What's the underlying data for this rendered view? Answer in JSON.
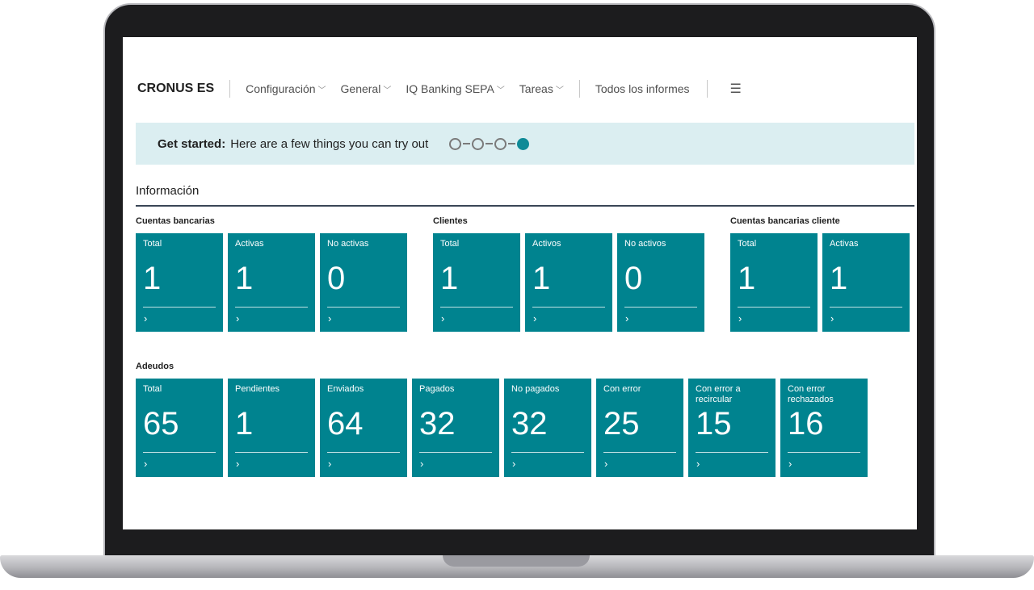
{
  "nav": {
    "brand": "CRONUS ES",
    "menus": [
      {
        "label": "Configuración"
      },
      {
        "label": "General"
      },
      {
        "label": "IQ Banking SEPA"
      },
      {
        "label": "Tareas"
      }
    ],
    "reports_label": "Todos los informes",
    "menu_icon": "hamburger-menu-icon"
  },
  "banner": {
    "title": "Get started:",
    "text": "Here are a few things you can try out",
    "steps_total": 4,
    "active_step": 4
  },
  "section": {
    "title": "Información"
  },
  "groups": {
    "cuentas": {
      "label": "Cuentas bancarias",
      "tiles": [
        {
          "label": "Total",
          "value": "1"
        },
        {
          "label": "Activas",
          "value": "1"
        },
        {
          "label": "No activas",
          "value": "0"
        }
      ]
    },
    "clientes": {
      "label": "Clientes",
      "tiles": [
        {
          "label": "Total",
          "value": "1"
        },
        {
          "label": "Activos",
          "value": "1"
        },
        {
          "label": "No activos",
          "value": "0"
        }
      ]
    },
    "cuentas_cliente": {
      "label": "Cuentas bancarias cliente",
      "tiles": [
        {
          "label": "Total",
          "value": "1"
        },
        {
          "label": "Activas",
          "value": "1"
        }
      ]
    },
    "adeudos": {
      "label": "Adeudos",
      "tiles": [
        {
          "label": "Total",
          "value": "65"
        },
        {
          "label": "Pendientes",
          "value": "1"
        },
        {
          "label": "Enviados",
          "value": "64"
        },
        {
          "label": "Pagados",
          "value": "32"
        },
        {
          "label": "No pagados",
          "value": "32"
        },
        {
          "label": "Con error",
          "value": "25"
        },
        {
          "label": "Con error a recircular",
          "value": "15"
        },
        {
          "label": "Con error rechazados",
          "value": "16"
        }
      ]
    }
  },
  "tile_arrow": "›",
  "colors": {
    "tile": "#00838f",
    "banner": "#dbeef1",
    "accent_step": "#0f8a97"
  }
}
